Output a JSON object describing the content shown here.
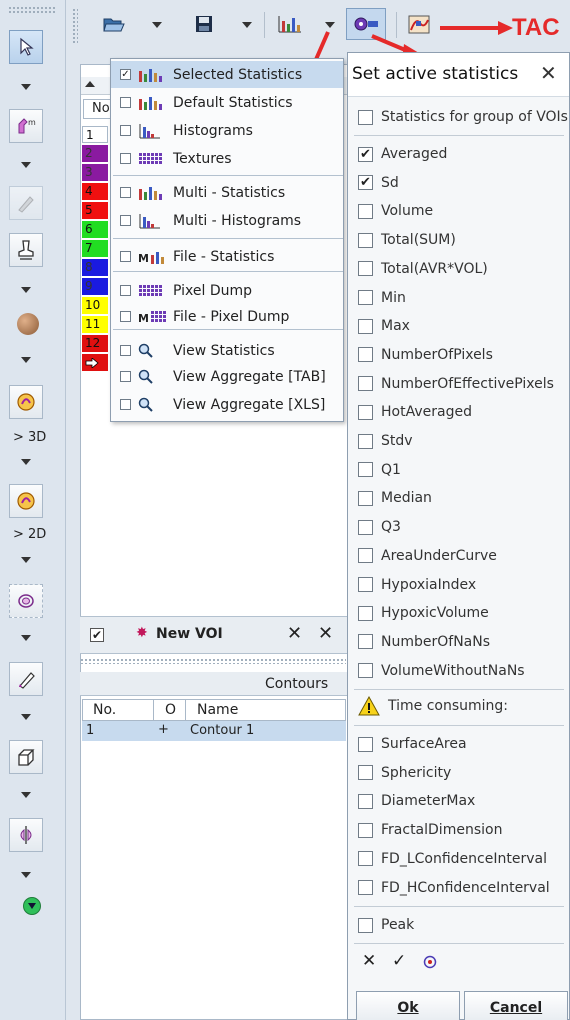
{
  "left_toolbar": {
    "label_3d": "> 3D",
    "label_2d": "> 2D"
  },
  "top_toolbar": {
    "tac_annotation": "TAC"
  },
  "main": {
    "table_header_no": "No",
    "rows": [
      {
        "label": "1",
        "color": "#ffffff"
      },
      {
        "label": "2",
        "color": "#8a1aa0"
      },
      {
        "label": "3",
        "color": "#8a1aa0"
      },
      {
        "label": "4",
        "color": "#f01010"
      },
      {
        "label": "5",
        "color": "#f01010"
      },
      {
        "label": "6",
        "color": "#22dd22"
      },
      {
        "label": "7",
        "color": "#22dd22"
      },
      {
        "label": "8",
        "color": "#1a1ae0"
      },
      {
        "label": "9",
        "color": "#1a1ae0"
      },
      {
        "label": "10",
        "color": "#ffff00"
      },
      {
        "label": "11",
        "color": "#ffff00"
      },
      {
        "label": "12",
        "color": "#e01010"
      }
    ],
    "new_voi_label": "New VOI",
    "contours_title": "Contours",
    "contours_header": {
      "no": "No.",
      "o": "O",
      "name": "Name"
    },
    "contours_row": {
      "no": "1",
      "o": "+",
      "name": "Contour 1"
    }
  },
  "menu": {
    "items": [
      {
        "label": "Selected Statistics",
        "checked": true,
        "icon": "bar-chart-icon",
        "selected": true
      },
      {
        "label": "Default Statistics",
        "checked": false,
        "icon": "bar-chart-icon"
      },
      {
        "label": "Histograms",
        "checked": false,
        "icon": "histogram-icon"
      },
      {
        "label": "Textures",
        "checked": false,
        "icon": "texture-grid-icon"
      },
      {
        "label": "Multi - Statistics",
        "checked": false,
        "icon": "multi-bar-chart-icon"
      },
      {
        "label": "Multi - Histograms",
        "checked": false,
        "icon": "multi-histogram-icon"
      },
      {
        "label": "File - Statistics",
        "checked": false,
        "icon": "file-statistics-icon"
      },
      {
        "label": "Pixel Dump",
        "checked": false,
        "icon": "pixel-grid-icon"
      },
      {
        "label": "File - Pixel Dump",
        "checked": false,
        "icon": "file-pixel-grid-icon"
      },
      {
        "label": "View Statistics",
        "checked": false,
        "icon": "magnifier-icon"
      },
      {
        "label": "View Aggregate [TAB]",
        "checked": false,
        "icon": "magnifier-icon"
      },
      {
        "label": "View Aggregate [XLS]",
        "checked": false,
        "icon": "magnifier-icon"
      }
    ]
  },
  "dialog": {
    "title": "Set active statistics",
    "group_option": "Statistics for group of VOIs",
    "stats": [
      {
        "label": "Averaged",
        "checked": true
      },
      {
        "label": "Sd",
        "checked": true
      },
      {
        "label": "Volume",
        "checked": false
      },
      {
        "label": "Total(SUM)",
        "checked": false
      },
      {
        "label": "Total(AVR*VOL)",
        "checked": false
      },
      {
        "label": "Min",
        "checked": false
      },
      {
        "label": "Max",
        "checked": false
      },
      {
        "label": "NumberOfPixels",
        "checked": false
      },
      {
        "label": "NumberOfEffectivePixels",
        "checked": false
      },
      {
        "label": "HotAveraged",
        "checked": false
      },
      {
        "label": "Stdv",
        "checked": false
      },
      {
        "label": "Q1",
        "checked": false
      },
      {
        "label": "Median",
        "checked": false
      },
      {
        "label": "Q3",
        "checked": false
      },
      {
        "label": "AreaUnderCurve",
        "checked": false
      },
      {
        "label": "HypoxiaIndex",
        "checked": false
      },
      {
        "label": "HypoxicVolume",
        "checked": false
      },
      {
        "label": "NumberOfNaNs",
        "checked": false
      },
      {
        "label": "VolumeWithoutNaNs",
        "checked": false
      }
    ],
    "time_consuming_label": "Time consuming:",
    "time_consuming_stats": [
      {
        "label": "SurfaceArea",
        "checked": false
      },
      {
        "label": "Sphericity",
        "checked": false
      },
      {
        "label": "DiameterMax",
        "checked": false
      },
      {
        "label": "FractalDimension",
        "checked": false
      },
      {
        "label": "FD_LConfidenceInterval",
        "checked": false
      },
      {
        "label": "FD_HConfidenceInterval",
        "checked": false
      }
    ],
    "peak_label": "Peak",
    "ok_label": "Ok",
    "cancel_label": "Cancel"
  },
  "colors": {
    "accent_red": "#e52a2a",
    "selection_blue": "#c7daee"
  }
}
